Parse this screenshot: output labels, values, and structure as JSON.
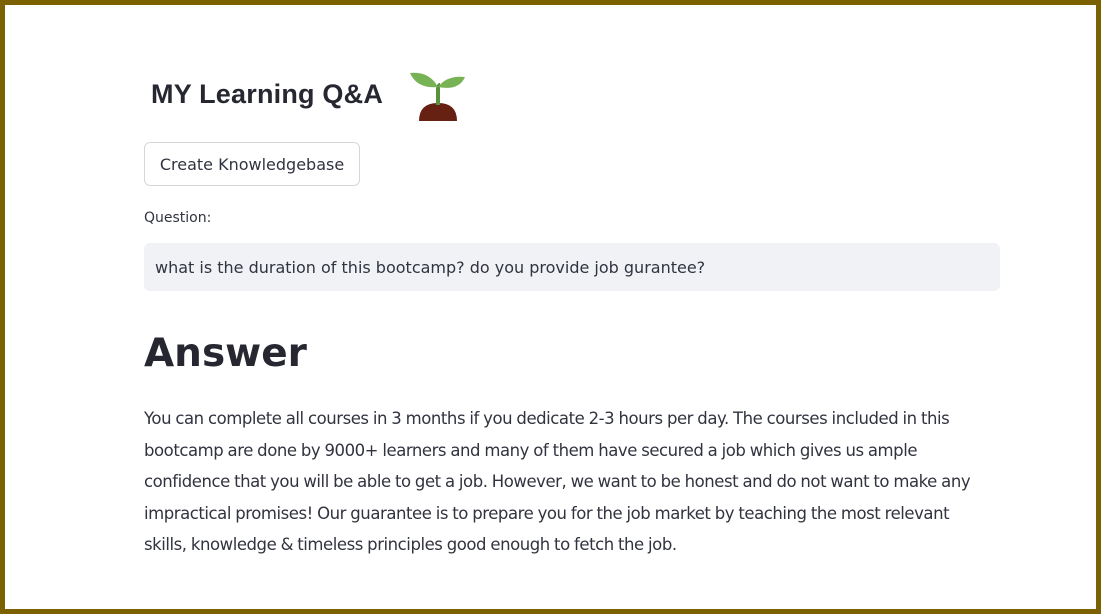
{
  "header": {
    "title": "MY Learning Q&A",
    "logo_icon": "seedling-icon"
  },
  "actions": {
    "create_kb_label": "Create Knowledgebase"
  },
  "question": {
    "label": "Question:",
    "value": "what is the duration of this bootcamp? do you provide job gurantee?"
  },
  "answer": {
    "heading": "Answer",
    "text": "You can complete all courses in 3 months if you dedicate 2-3 hours per day. The courses included in this bootcamp are done by 9000+ learners and many of them have secured a job which gives us ample confidence that you will be able to get a job. However, we want to be honest and do not want to make any impractical promises! Our guarantee is to prepare you for the job market by teaching the most relevant skills, knowledge & timeless principles good enough to fetch the job."
  },
  "colors": {
    "frame_border": "#7b6100",
    "input_bg": "#f0f2f6",
    "text": "#31333f",
    "leaf_green": "#77b255",
    "soil_brown": "#662113"
  }
}
